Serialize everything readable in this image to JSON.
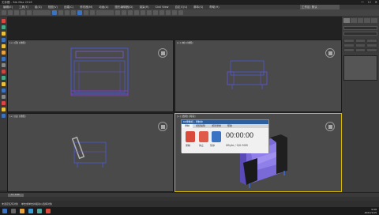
{
  "titlebar": {
    "left_text": "无标题 - 3ds Max 2016",
    "center_text": "工作区: 默认",
    "controls": [
      "—",
      "☐",
      "✕"
    ]
  },
  "menubar": {
    "items": [
      "编辑(E)",
      "工具(T)",
      "组(G)",
      "视图(V)",
      "创建(C)",
      "修改器(M)",
      "动画(A)",
      "图形编辑器(D)",
      "渲染(R)",
      "Civil View",
      "自定义(U)",
      "脚本(S)",
      "帮助(H)"
    ],
    "workspace": "工作区: 默认"
  },
  "viewports": {
    "top_left_label": "[+] [顶] [线框]",
    "top_right_label": "[+] [前] [线框]",
    "bottom_left_label": "[+] [左] [线框]",
    "bottom_right_label": "[+] [透视] [真实]"
  },
  "recorder": {
    "title": "KK录像机 - 录制中",
    "tabs": [
      "录制",
      "视频编辑",
      "游戏录制",
      "帮助"
    ],
    "record_label": "录制",
    "stop_label": "停止",
    "pause_label": "暂停",
    "time": "00:00:00",
    "size": "0Byte / 0/0.9GB"
  },
  "timeline": {
    "frames": "0 / 100"
  },
  "status": {
    "selection": "未选定任何对象",
    "hint": "单击或单击并拖动以选择对象"
  },
  "taskbar": {
    "time": "9:08",
    "date": "2021/1/15"
  }
}
